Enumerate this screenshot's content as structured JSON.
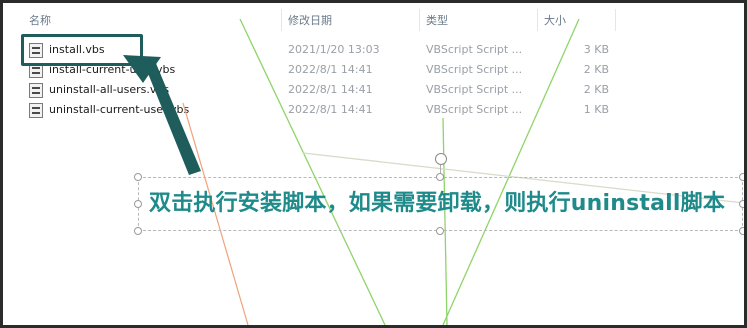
{
  "columns": {
    "name": "名称",
    "date_modified": "修改日期",
    "type": "类型",
    "size": "大小"
  },
  "files": [
    {
      "name": "install.vbs",
      "date": "2021/1/20 13:03",
      "type": "VBScript Script ...",
      "size": "3 KB"
    },
    {
      "name": "install-current-user.vbs",
      "date": "2022/8/1 14:41",
      "type": "VBScript Script ...",
      "size": "2 KB"
    },
    {
      "name": "uninstall-all-users.vbs",
      "date": "2022/8/1 14:41",
      "type": "VBScript Script ...",
      "size": "2 KB"
    },
    {
      "name": "uninstall-current-user.vbs",
      "date": "2022/8/1 14:41",
      "type": "VBScript Script ...",
      "size": "1 KB"
    }
  ],
  "annotation": {
    "text": "双击执行安装脚本，如果需要卸载，则执行uninstall脚本"
  },
  "colors": {
    "highlight_border": "#1f5c5c",
    "annotation_text": "#1f8a8a",
    "arrow": "#1f5c5c"
  },
  "icons": {
    "file": "vbscript-file-icon"
  }
}
